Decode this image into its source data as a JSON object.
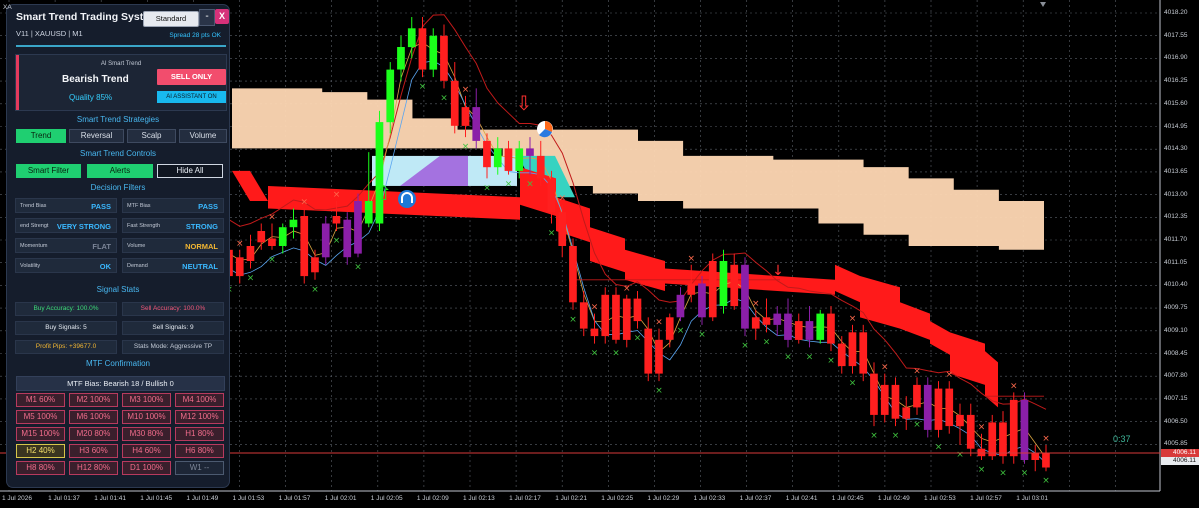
{
  "panel": {
    "title": "Smart Trend Trading System",
    "mode_button": "Standard",
    "minimize_label": "-",
    "close_label": "X",
    "subtitle": "V11 | XAUUSD | M1",
    "spread": "Spread 28 pts OK",
    "trend_box": {
      "ai_label": "AI Smart Trend",
      "trend": "Bearish Trend",
      "quality": "Quality 85%",
      "signal_button": "SELL ONLY",
      "assistant_button": "AI ASSISTANT ON"
    },
    "strategies": {
      "heading": "Smart Trend Strategies",
      "buttons": [
        "Trend",
        "Reversal",
        "Scalp",
        "Volume"
      ]
    },
    "controls": {
      "heading": "Smart Trend Controls",
      "buttons": [
        "Smart Filter",
        "Alerts",
        "Hide All"
      ]
    },
    "filters": {
      "heading": "Decision Filters",
      "cells": [
        {
          "label": "Trend Bias",
          "value": "PASS",
          "color": "#3ab8ff"
        },
        {
          "label": "MTF Bias",
          "value": "PASS",
          "color": "#3ab8ff"
        },
        {
          "label": "end Strengt",
          "value": "VERY STRONG",
          "color": "#3ab8ff"
        },
        {
          "label": "Fast Strength",
          "value": "STRONG",
          "color": "#3ab8ff"
        },
        {
          "label": "Momentum",
          "value": "FLAT",
          "color": "#7b8496"
        },
        {
          "label": "Volume",
          "value": "NORMAL",
          "color": "#f2b632"
        },
        {
          "label": "Volatility",
          "value": "OK",
          "color": "#3ab8ff"
        },
        {
          "label": "Demand",
          "value": "NEUTRAL",
          "color": "#3ab8ff"
        }
      ]
    },
    "stats": {
      "heading": "Signal Stats",
      "cells": [
        {
          "text": "Buy Accuracy: 100.0%",
          "color": "#3ddc78"
        },
        {
          "text": "Sell Accuracy: 100.0%",
          "color": "#f2587a"
        },
        {
          "text": "Buy Signals: 5",
          "color": "#e6ebf2"
        },
        {
          "text": "Sell Signals: 9",
          "color": "#e6ebf2"
        },
        {
          "text": "Profit Pips: +39677.0",
          "color": "#f2b632"
        },
        {
          "text": "Stats Mode: Aggressive TP",
          "color": "#c3cad6"
        }
      ]
    },
    "mtf": {
      "heading": "MTF Confirmation",
      "bias": "MTF Bias: Bearish 18 / Bullish 0",
      "timeframes": [
        {
          "label": "M1 60%",
          "state": "red"
        },
        {
          "label": "M2 100%",
          "state": "red"
        },
        {
          "label": "M3 100%",
          "state": "red"
        },
        {
          "label": "M4 100%",
          "state": "red"
        },
        {
          "label": "M5 100%",
          "state": "red"
        },
        {
          "label": "M6 100%",
          "state": "red"
        },
        {
          "label": "M10 100%",
          "state": "red"
        },
        {
          "label": "M12 100%",
          "state": "red"
        },
        {
          "label": "M15 100%",
          "state": "red"
        },
        {
          "label": "M20 80%",
          "state": "red"
        },
        {
          "label": "M30 80%",
          "state": "red"
        },
        {
          "label": "H1 80%",
          "state": "red"
        },
        {
          "label": "H2 40%",
          "state": "yellow"
        },
        {
          "label": "H3 60%",
          "state": "red"
        },
        {
          "label": "H4 60%",
          "state": "red"
        },
        {
          "label": "H6 80%",
          "state": "red"
        },
        {
          "label": "H8 80%",
          "state": "red"
        },
        {
          "label": "H12 80%",
          "state": "red"
        },
        {
          "label": "D1 100%",
          "state": "red"
        },
        {
          "label": "W1 --",
          "state": "neutral"
        }
      ]
    }
  },
  "chart": {
    "corner_label": "XA",
    "timer": "0:37",
    "current_price": "4006.11",
    "price_labels": [
      "4018.20",
      "4017.55",
      "4016.90",
      "4016.25",
      "4015.60",
      "4014.95",
      "4014.30",
      "4013.65",
      "4013.00",
      "4012.35",
      "4011.70",
      "4011.05",
      "4010.40",
      "4009.75",
      "4009.10",
      "4008.45",
      "4007.80",
      "4007.15",
      "4006.50",
      "4005.85"
    ],
    "time_labels": [
      "1 Jul 2026",
      "1 Jul 01:37",
      "1 Jul 01:41",
      "1 Jul 01:45",
      "1 Jul 01:49",
      "1 Jul 01:53",
      "1 Jul 01:57",
      "1 Jul 02:01",
      "1 Jul 02:05",
      "1 Jul 02:09",
      "1 Jul 02:13",
      "1 Jul 02:17",
      "1 Jul 02:21",
      "1 Jul 02:25",
      "1 Jul 02:29",
      "1 Jul 02:33",
      "1 Jul 02:37",
      "1 Jul 02:41",
      "1 Jul 02:45",
      "1 Jul 02:49",
      "1 Jul 02:53",
      "1 Jul 02:57",
      "1 Jul 03:01"
    ]
  },
  "chart_data": {
    "type": "candlestick",
    "symbol": "XAUUSD",
    "timeframe": "M1",
    "ylim": [
      4005.5,
      4018.5
    ],
    "candles": [
      {
        "o": 4011.9,
        "h": 4012.5,
        "l": 4011.1,
        "c": 4011.2,
        "color": "red"
      },
      {
        "o": 4011.2,
        "h": 4011.9,
        "l": 4011.0,
        "c": 4011.7,
        "color": "red"
      },
      {
        "o": 4011.6,
        "h": 4012.3,
        "l": 4011.4,
        "c": 4012.0,
        "color": "red"
      },
      {
        "o": 4012.1,
        "h": 4012.6,
        "l": 4011.9,
        "c": 4012.4,
        "color": "red"
      },
      {
        "o": 4012.2,
        "h": 4012.6,
        "l": 4011.9,
        "c": 4012.0,
        "color": "red"
      },
      {
        "o": 4012.0,
        "h": 4012.6,
        "l": 4011.8,
        "c": 4012.5,
        "color": "green"
      },
      {
        "o": 4012.5,
        "h": 4013.0,
        "l": 4012.2,
        "c": 4012.7,
        "color": "green"
      },
      {
        "o": 4012.8,
        "h": 4013.0,
        "l": 4011.0,
        "c": 4011.2,
        "color": "red"
      },
      {
        "o": 4011.3,
        "h": 4011.9,
        "l": 4011.1,
        "c": 4011.7,
        "color": "red"
      },
      {
        "o": 4011.7,
        "h": 4012.8,
        "l": 4011.5,
        "c": 4012.6,
        "color": "purple"
      },
      {
        "o": 4012.6,
        "h": 4013.2,
        "l": 4012.4,
        "c": 4012.8,
        "color": "red"
      },
      {
        "o": 4012.7,
        "h": 4012.9,
        "l": 4011.5,
        "c": 4011.7,
        "color": "purple"
      },
      {
        "o": 4011.8,
        "h": 4013.4,
        "l": 4011.7,
        "c": 4013.2,
        "color": "purple"
      },
      {
        "o": 4013.2,
        "h": 4014.5,
        "l": 4012.5,
        "c": 4012.6,
        "color": "green"
      },
      {
        "o": 4012.6,
        "h": 4015.6,
        "l": 4012.4,
        "c": 4015.3,
        "color": "green"
      },
      {
        "o": 4015.3,
        "h": 4016.9,
        "l": 4015.0,
        "c": 4016.7,
        "color": "green"
      },
      {
        "o": 4016.7,
        "h": 4017.6,
        "l": 4016.4,
        "c": 4017.3,
        "color": "green"
      },
      {
        "o": 4017.3,
        "h": 4018.1,
        "l": 4017.0,
        "c": 4017.8,
        "color": "green"
      },
      {
        "o": 4017.8,
        "h": 4018.1,
        "l": 4016.5,
        "c": 4016.7,
        "color": "red"
      },
      {
        "o": 4016.7,
        "h": 4017.8,
        "l": 4016.5,
        "c": 4017.6,
        "color": "green"
      },
      {
        "o": 4017.6,
        "h": 4017.9,
        "l": 4016.2,
        "c": 4016.4,
        "color": "red"
      },
      {
        "o": 4016.4,
        "h": 4016.9,
        "l": 4015.0,
        "c": 4015.2,
        "color": "red"
      },
      {
        "o": 4015.2,
        "h": 4016.0,
        "l": 4014.9,
        "c": 4015.7,
        "color": "red"
      },
      {
        "o": 4015.7,
        "h": 4016.2,
        "l": 4014.6,
        "c": 4014.8,
        "color": "purple"
      },
      {
        "o": 4014.8,
        "h": 4015.0,
        "l": 4013.8,
        "c": 4014.1,
        "color": "red"
      },
      {
        "o": 4014.1,
        "h": 4014.9,
        "l": 4013.9,
        "c": 4014.6,
        "color": "green"
      },
      {
        "o": 4014.6,
        "h": 4014.8,
        "l": 4013.9,
        "c": 4014.0,
        "color": "red"
      },
      {
        "o": 4014.0,
        "h": 4014.8,
        "l": 4013.8,
        "c": 4014.6,
        "color": "green"
      },
      {
        "o": 4014.6,
        "h": 4014.9,
        "l": 4013.9,
        "c": 4014.4,
        "color": "purple"
      },
      {
        "o": 4014.4,
        "h": 4014.8,
        "l": 4013.6,
        "c": 4013.8,
        "color": "red"
      },
      {
        "o": 4013.8,
        "h": 4014.0,
        "l": 4012.6,
        "c": 4012.9,
        "color": "red"
      },
      {
        "o": 4012.9,
        "h": 4013.1,
        "l": 4011.7,
        "c": 4012.0,
        "color": "red"
      },
      {
        "o": 4012.0,
        "h": 4012.2,
        "l": 4010.3,
        "c": 4010.5,
        "color": "red"
      },
      {
        "o": 4010.5,
        "h": 4010.8,
        "l": 4009.6,
        "c": 4009.8,
        "color": "red"
      },
      {
        "o": 4009.8,
        "h": 4010.2,
        "l": 4009.4,
        "c": 4009.6,
        "color": "red"
      },
      {
        "o": 4009.6,
        "h": 4010.9,
        "l": 4009.4,
        "c": 4010.7,
        "color": "red"
      },
      {
        "o": 4010.7,
        "h": 4010.9,
        "l": 4009.4,
        "c": 4009.5,
        "color": "red"
      },
      {
        "o": 4009.5,
        "h": 4010.7,
        "l": 4009.3,
        "c": 4010.6,
        "color": "red"
      },
      {
        "o": 4010.6,
        "h": 4010.8,
        "l": 4009.8,
        "c": 4010.0,
        "color": "red"
      },
      {
        "o": 4009.8,
        "h": 4010.1,
        "l": 4008.4,
        "c": 4008.6,
        "color": "red"
      },
      {
        "o": 4008.6,
        "h": 4009.8,
        "l": 4008.4,
        "c": 4009.5,
        "color": "red"
      },
      {
        "o": 4009.5,
        "h": 4010.2,
        "l": 4009.3,
        "c": 4010.1,
        "color": "red"
      },
      {
        "o": 4010.1,
        "h": 4010.9,
        "l": 4010.0,
        "c": 4010.7,
        "color": "purple"
      },
      {
        "o": 4010.7,
        "h": 4011.5,
        "l": 4010.5,
        "c": 4011.0,
        "color": "red"
      },
      {
        "o": 4011.0,
        "h": 4011.2,
        "l": 4009.9,
        "c": 4010.1,
        "color": "purple"
      },
      {
        "o": 4010.1,
        "h": 4011.8,
        "l": 4010.0,
        "c": 4011.6,
        "color": "red"
      },
      {
        "o": 4011.6,
        "h": 4011.9,
        "l": 4010.2,
        "c": 4010.4,
        "color": "green"
      },
      {
        "o": 4010.4,
        "h": 4011.8,
        "l": 4010.3,
        "c": 4011.5,
        "color": "red"
      },
      {
        "o": 4011.5,
        "h": 4011.7,
        "l": 4009.6,
        "c": 4009.8,
        "color": "purple"
      },
      {
        "o": 4009.8,
        "h": 4010.3,
        "l": 4009.5,
        "c": 4010.1,
        "color": "red"
      },
      {
        "o": 4010.1,
        "h": 4010.6,
        "l": 4009.7,
        "c": 4009.9,
        "color": "red"
      },
      {
        "o": 4009.9,
        "h": 4010.4,
        "l": 4009.6,
        "c": 4010.2,
        "color": "purple"
      },
      {
        "o": 4010.2,
        "h": 4010.6,
        "l": 4009.3,
        "c": 4009.5,
        "color": "purple"
      },
      {
        "o": 4009.5,
        "h": 4010.2,
        "l": 4009.4,
        "c": 4010.0,
        "color": "red"
      },
      {
        "o": 4010.0,
        "h": 4010.4,
        "l": 4009.3,
        "c": 4009.5,
        "color": "purple"
      },
      {
        "o": 4009.5,
        "h": 4010.3,
        "l": 4009.4,
        "c": 4010.2,
        "color": "green"
      },
      {
        "o": 4010.2,
        "h": 4010.4,
        "l": 4009.2,
        "c": 4009.4,
        "color": "red"
      },
      {
        "o": 4009.4,
        "h": 4009.6,
        "l": 4008.6,
        "c": 4008.8,
        "color": "red"
      },
      {
        "o": 4008.8,
        "h": 4009.9,
        "l": 4008.6,
        "c": 4009.7,
        "color": "red"
      },
      {
        "o": 4009.7,
        "h": 4009.9,
        "l": 4008.4,
        "c": 4008.6,
        "color": "red"
      },
      {
        "o": 4008.6,
        "h": 4008.9,
        "l": 4007.2,
        "c": 4007.5,
        "color": "red"
      },
      {
        "o": 4007.5,
        "h": 4008.6,
        "l": 4007.3,
        "c": 4008.3,
        "color": "red"
      },
      {
        "o": 4008.3,
        "h": 4008.5,
        "l": 4007.2,
        "c": 4007.4,
        "color": "red"
      },
      {
        "o": 4007.4,
        "h": 4008.0,
        "l": 4007.1,
        "c": 4007.7,
        "color": "red"
      },
      {
        "o": 4007.7,
        "h": 4008.5,
        "l": 4007.5,
        "c": 4008.3,
        "color": "red"
      },
      {
        "o": 4008.3,
        "h": 4008.5,
        "l": 4006.9,
        "c": 4007.1,
        "color": "purple"
      },
      {
        "o": 4007.1,
        "h": 4008.4,
        "l": 4006.9,
        "c": 4008.2,
        "color": "red"
      },
      {
        "o": 4008.2,
        "h": 4008.4,
        "l": 4007.0,
        "c": 4007.2,
        "color": "red"
      },
      {
        "o": 4007.2,
        "h": 4007.8,
        "l": 4006.7,
        "c": 4007.5,
        "color": "red"
      },
      {
        "o": 4007.5,
        "h": 4007.8,
        "l": 4006.4,
        "c": 4006.6,
        "color": "red"
      },
      {
        "o": 4006.6,
        "h": 4007.0,
        "l": 4006.3,
        "c": 4006.4,
        "color": "red"
      },
      {
        "o": 4006.4,
        "h": 4007.5,
        "l": 4006.3,
        "c": 4007.3,
        "color": "red"
      },
      {
        "o": 4007.3,
        "h": 4007.6,
        "l": 4006.2,
        "c": 4006.4,
        "color": "red"
      },
      {
        "o": 4006.4,
        "h": 4008.1,
        "l": 4006.2,
        "c": 4007.9,
        "color": "red"
      },
      {
        "o": 4007.9,
        "h": 4008.1,
        "l": 4006.2,
        "c": 4006.3,
        "color": "purple"
      },
      {
        "o": 4006.3,
        "h": 4006.7,
        "l": 4006.0,
        "c": 4006.5,
        "color": "red"
      },
      {
        "o": 4006.5,
        "h": 4006.7,
        "l": 4006.0,
        "c": 4006.1,
        "color": "red"
      }
    ]
  }
}
